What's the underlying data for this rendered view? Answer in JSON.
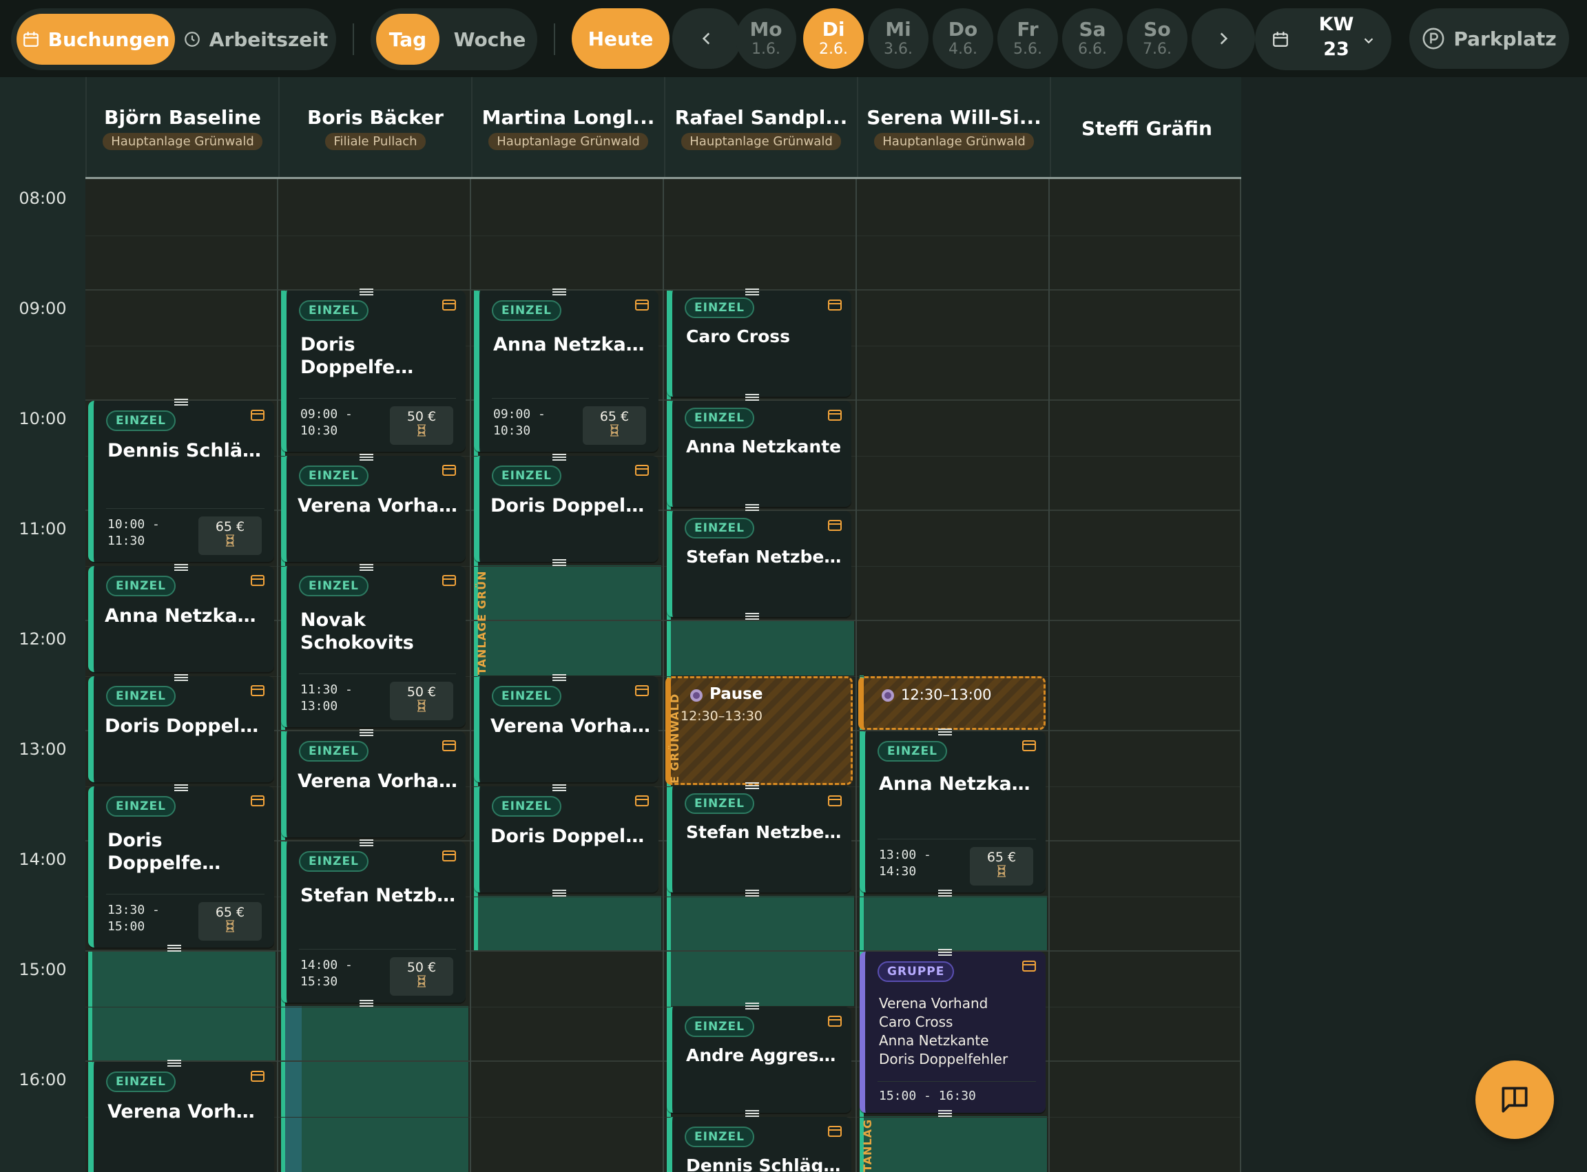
{
  "toolbar": {
    "bookings_label": "Buchungen",
    "worktime_label": "Arbeitszeit",
    "day_label": "Tag",
    "week_label": "Woche",
    "today_label": "Heute",
    "days": [
      {
        "name": "Mo",
        "date": "1.6."
      },
      {
        "name": "Di",
        "date": "2.6."
      },
      {
        "name": "Mi",
        "date": "3.6."
      },
      {
        "name": "Do",
        "date": "4.6."
      },
      {
        "name": "Fr",
        "date": "5.6."
      },
      {
        "name": "Sa",
        "date": "6.6."
      },
      {
        "name": "So",
        "date": "7.6."
      }
    ],
    "week_prefix": "KW",
    "week_number": "23",
    "parking_label": "Parkplatz"
  },
  "columns": [
    {
      "name": "Björn Baseline",
      "location": "Hauptanlage Grünwald"
    },
    {
      "name": "Boris Bäcker",
      "location": "Filiale Pullach"
    },
    {
      "name": "Martina Longl...",
      "location": "Hauptanlage Grünwald"
    },
    {
      "name": "Rafael Sandpl...",
      "location": "Hauptanlage Grünwald"
    },
    {
      "name": "Serena Will-Si...",
      "location": "Hauptanlage Grünwald"
    },
    {
      "name": "Steffi Gräfin",
      "location": ""
    }
  ],
  "times": [
    "08:00",
    "09:00",
    "10:00",
    "11:00",
    "12:00",
    "13:00",
    "14:00",
    "15:00",
    "16:00"
  ],
  "cards": {
    "c0a": {
      "type": "EINZEL",
      "name": "Dennis Schläger",
      "time": "10:00 -\n11:30",
      "price": "65 €"
    },
    "c0b": {
      "type": "EINZEL",
      "name": "Anna Netzkante"
    },
    "c0c": {
      "type": "EINZEL",
      "name": "Doris Doppelfeh..."
    },
    "c0d": {
      "type": "EINZEL",
      "name": "Doris Doppelfehler",
      "time": "13:30 -\n15:00",
      "price": "65 €"
    },
    "c0e": {
      "type": "EINZEL",
      "name": "Verena Vorhand"
    },
    "c1a": {
      "type": "EINZEL",
      "name": "Doris Doppelfehler",
      "time": "09:00 -\n10:30",
      "price": "50 €"
    },
    "c1b": {
      "type": "EINZEL",
      "name": "Verena Vorhand"
    },
    "c1c": {
      "type": "EINZEL",
      "name": "Novak Schokovits",
      "time": "11:30 -\n13:00",
      "price": "50 €"
    },
    "c1d": {
      "type": "EINZEL",
      "name": "Verena Vorhand"
    },
    "c1e": {
      "type": "EINZEL",
      "name": "Stefan Netzberg",
      "time": "14:00 -\n15:30",
      "price": "50 €"
    },
    "c2a": {
      "type": "EINZEL",
      "name": "Anna Netzkante",
      "time": "09:00 -\n10:30",
      "price": "65 €"
    },
    "c2b": {
      "type": "EINZEL",
      "name": "Doris Doppelfeh..."
    },
    "c2c": {
      "type": "EINZEL",
      "name": "Verena Vorhand"
    },
    "c2d": {
      "type": "EINZEL",
      "name": "Doris Doppelfeh..."
    },
    "c3a": {
      "type": "EINZEL",
      "name": "Caro Cross"
    },
    "c3b": {
      "type": "EINZEL",
      "name": "Anna Netzkante"
    },
    "c3c": {
      "type": "EINZEL",
      "name": "Stefan Netzberg"
    },
    "c3d": {
      "type": "EINZEL",
      "name": "Stefan Netzberg"
    },
    "c3e": {
      "type": "EINZEL",
      "name": "Andre Aggressiv"
    },
    "c3f": {
      "type": "EINZEL",
      "name": "Dennis Schläger"
    },
    "c4a": {
      "type": "EINZEL",
      "name": "Anna Netzkante",
      "time": "13:00 -\n14:30",
      "price": "65 €"
    },
    "c4b": {
      "type": "GRUPPE",
      "participants": [
        "Verena Vorhand",
        "Caro Cross",
        "Anna Netzkante",
        "Doris Doppelfehler"
      ],
      "time": "15:00 - 16:30"
    }
  },
  "pauses": {
    "p3": {
      "label": "Pause",
      "time": "12:30–13:30"
    },
    "p4": {
      "time": "12:30–13:00"
    }
  },
  "vertical_labels": {
    "martina": "TANLAGE GRÜN",
    "rafael": "E GRÜNWALD",
    "serena": "TANLAG"
  },
  "colors": {
    "accent": "#f2a33a",
    "einzel": "#2fbe92",
    "gruppe": "#7f73d8",
    "pause": "#d98b22"
  }
}
